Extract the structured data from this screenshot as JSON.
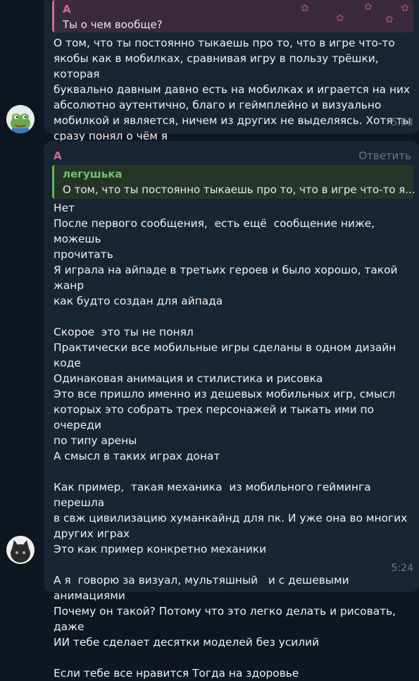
{
  "message1": {
    "reply": {
      "author": "А",
      "text": "Ты о чем вообще?"
    },
    "text": "О том, что ты постоянно тыкаешь про то, что в игре что-то\nякобы как в мобилках, сравнивая игру в пользу трёшки, которая\nбуквально давным давно есть на мобилках и играется на них\nабсолютно аутентично, благо и геймплейно и визуально\nмобилкой и является, ничем из других не выделяясь. Хотя ты\nсразу понял о чём я",
    "time": "5:03",
    "avatar_icon": "pepe-frog-avatar"
  },
  "message2": {
    "author": "А",
    "reply_action": "Ответить",
    "reply": {
      "author": "легушька",
      "text": "О том, что ты постоянно тыкаешь про то, что в игре что-то я..."
    },
    "text": "Нет\nПосле первого сообщения,  есть ещё  сообщение ниже, можешь\nпрочитать\nЯ играла на айпаде в третьих героев и было хорошо, такой жанр\nкак будто создан для айпада\n\nСкорое  это ты не понял\nПрактически все мобильные игры сделаны в одном дизайн коде\nОдинаковая анимация и стилистика и рисовка\nЭто все пришло именно из дешевых мобильных игр, смысл\nкоторых это собрать трех персонажей и тыкать ими по очереди\nпо типу арены\nА смысл в таких играх донат\n\nКак пример,  такая механика  из мобильного гейминга перешла\nв свж цивилизацию хуманкайнд для пк. И уже она во многих\nдругих играх\nЭто как пример конкретно механики\n\nА я  говорю за визуал, мультяшный   и с дешевыми анимациями\nПочему он такой? Потому что это легко делать и рисовать, даже\nИИ тебе сделает десятки моделей без усилий\n\nЕсли тебе все нравится Тогда на здоровье",
    "time": "5:24",
    "avatar_icon": "dark-cat-avatar"
  },
  "colors": {
    "background": "#0e1621",
    "bubble": "#182533",
    "author_pink": "#d06a8a",
    "reply_green": "#5fb85f",
    "meta_gray": "#6d7883"
  }
}
